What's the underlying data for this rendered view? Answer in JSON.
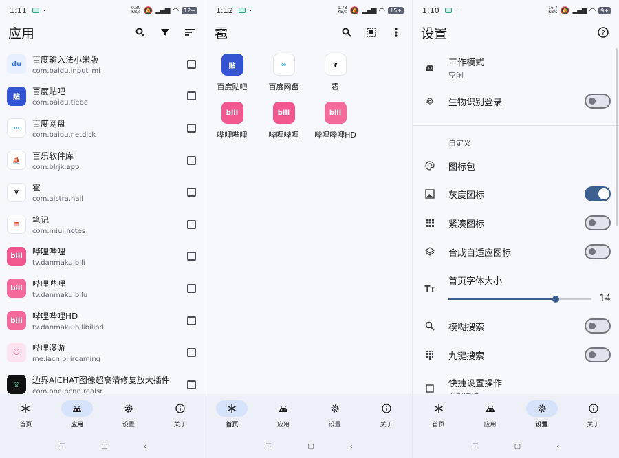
{
  "screens": [
    {
      "status": {
        "time": "1:11",
        "speed": "0.30\nKB/s",
        "battery": "12+"
      },
      "appbar": {
        "title": "应用"
      },
      "apps": [
        {
          "name": "百度输入法小米版",
          "pkg": "com.baidu.input_mi",
          "icon_text": "du",
          "color": "#2f6fe0",
          "bg": "#e7f0ff"
        },
        {
          "name": "百度贴吧",
          "pkg": "com.baidu.tieba",
          "icon_text": "贴",
          "color": "#ffffff",
          "bg": "#3554d1"
        },
        {
          "name": "百度网盘",
          "pkg": "com.baidu.netdisk",
          "icon_text": "∞",
          "color": "#33a8e8",
          "bg": "#ffffff"
        },
        {
          "name": "百乐软件库",
          "pkg": "com.blrjk.app",
          "icon_text": "⛵",
          "color": "#222222",
          "bg": "#ffffff"
        },
        {
          "name": "雹",
          "pkg": "com.aistra.hail",
          "icon_text": "⩛",
          "color": "#111111",
          "bg": "#ffffff"
        },
        {
          "name": "笔记",
          "pkg": "com.miui.notes",
          "icon_text": "≡",
          "color": "#e85c4a",
          "bg": "#ffffff"
        },
        {
          "name": "哔哩哔哩",
          "pkg": "tv.danmaku.bili",
          "icon_text": "bili",
          "color": "#ffffff",
          "bg": "#f2578f"
        },
        {
          "name": "哔哩哔哩",
          "pkg": "tv.danmaku.bilu",
          "icon_text": "bili",
          "color": "#ffffff",
          "bg": "#f46a9a"
        },
        {
          "name": "哔哩哔哩HD",
          "pkg": "tv.danmaku.bilibilihd",
          "icon_text": "bili",
          "color": "#ffffff",
          "bg": "#f46a9a"
        },
        {
          "name": "哔哩漫游",
          "pkg": "me.iacn.biliroaming",
          "icon_text": "☺",
          "color": "#e56a9c",
          "bg": "#fde3ef"
        },
        {
          "name": "边界AICHAT图像超高清修复放大插件",
          "pkg": "com.one.ncnn.realsr",
          "icon_text": "◎",
          "color": "#55e0b5",
          "bg": "#111111"
        }
      ],
      "nav": [
        {
          "label": "首页",
          "icon": "snowflake-icon",
          "active": false
        },
        {
          "label": "应用",
          "icon": "android-icon",
          "active": true
        },
        {
          "label": "设置",
          "icon": "gear-icon",
          "active": false
        },
        {
          "label": "关于",
          "icon": "info-icon",
          "active": false
        }
      ]
    },
    {
      "status": {
        "time": "1:12",
        "speed": "1.78\nKB/s",
        "battery": "15+"
      },
      "appbar": {
        "title": "雹"
      },
      "grid": [
        {
          "name": "百度贴吧",
          "icon_text": "贴",
          "color": "#ffffff",
          "bg": "#3554d1"
        },
        {
          "name": "百度网盘",
          "icon_text": "∞",
          "color": "#33a8e8",
          "bg": "#ffffff"
        },
        {
          "name": "雹",
          "icon_text": "⩛",
          "color": "#111111",
          "bg": "#ffffff"
        },
        {
          "name": "哔哩哔哩",
          "icon_text": "bili",
          "color": "#ffffff",
          "bg": "#f2578f"
        },
        {
          "name": "哔哩哔哩",
          "icon_text": "bili",
          "color": "#ffffff",
          "bg": "#f2578f"
        },
        {
          "name": "哔哩哔哩HD",
          "icon_text": "bili",
          "color": "#ffffff",
          "bg": "#f46a9a"
        }
      ],
      "fab_icon": "❄",
      "nav": [
        {
          "label": "首页",
          "icon": "snowflake-icon",
          "active": true
        },
        {
          "label": "应用",
          "icon": "android-icon",
          "active": false
        },
        {
          "label": "设置",
          "icon": "gear-icon",
          "active": false
        },
        {
          "label": "关于",
          "icon": "info-icon",
          "active": false
        }
      ]
    },
    {
      "status": {
        "time": "1:10",
        "speed": "16.7\nKB/s",
        "battery": "9+"
      },
      "appbar": {
        "title": "设置"
      },
      "settings": {
        "work_mode": {
          "title": "工作模式",
          "value": "空闲"
        },
        "biometric": {
          "title": "生物识别登录",
          "on": false
        },
        "category": "自定义",
        "icon_pack": {
          "title": "图标包"
        },
        "gray_icon": {
          "title": "灰度图标",
          "on": true
        },
        "compact_icon": {
          "title": "紧凑图标",
          "on": false
        },
        "adaptive_icon": {
          "title": "合成自适应图标",
          "on": false
        },
        "font_size": {
          "title": "首页字体大小",
          "value": "14",
          "fraction": 0.75
        },
        "fuzzy_search": {
          "title": "模糊搜索",
          "on": false
        },
        "t9_search": {
          "title": "九键搜索",
          "on": false
        },
        "quick_settings": {
          "title": "快捷设置操作",
          "value": "全部冻结"
        }
      },
      "nav": [
        {
          "label": "首页",
          "icon": "snowflake-icon",
          "active": false
        },
        {
          "label": "应用",
          "icon": "android-icon",
          "active": false
        },
        {
          "label": "设置",
          "icon": "gear-icon",
          "active": true
        },
        {
          "label": "关于",
          "icon": "info-icon",
          "active": false
        }
      ]
    }
  ]
}
